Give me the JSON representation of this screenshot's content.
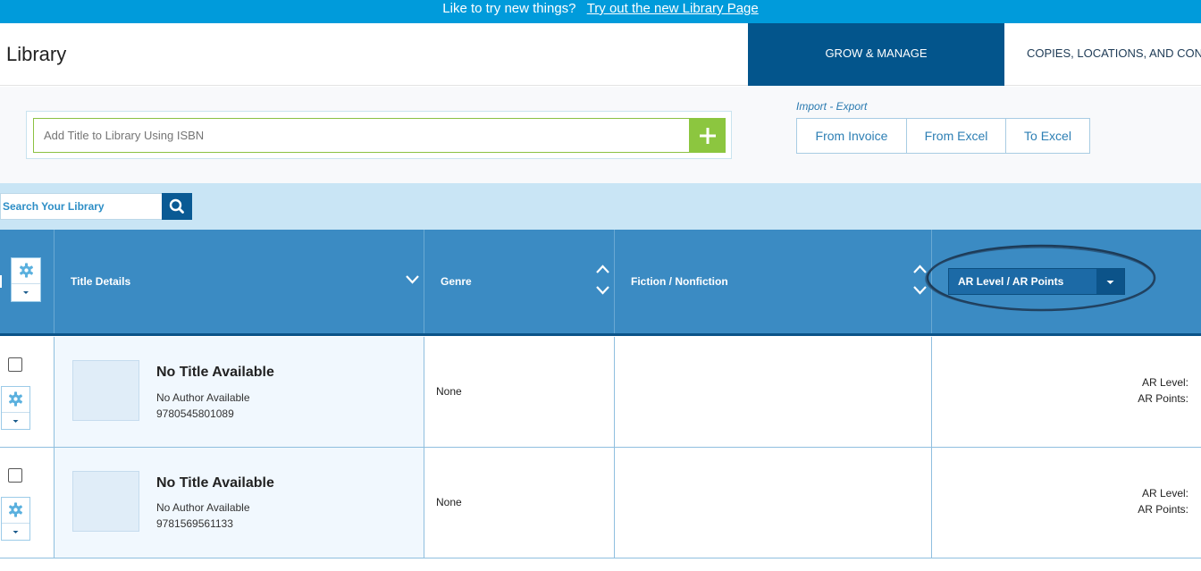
{
  "banner": {
    "prompt": "Like to try new things?",
    "link": "Try out the new Library Page"
  },
  "header": {
    "title": "Library",
    "tabs": [
      "GROW & MANAGE",
      "COPIES, LOCATIONS, AND COND"
    ],
    "active_tab": "GROW & MANAGE"
  },
  "isbn": {
    "placeholder": "Add Title to Library Using ISBN",
    "add_icon": "plus-icon"
  },
  "import_export": {
    "label": "Import - Export",
    "buttons": [
      "From Invoice",
      "From Excel",
      "To Excel"
    ]
  },
  "search": {
    "placeholder": "Search Your Library",
    "icon": "search-icon"
  },
  "table": {
    "columns": {
      "title": "Title Details",
      "genre": "Genre",
      "fiction": "Fiction / Nonfiction",
      "ar": "AR Level / AR Points"
    },
    "rows": [
      {
        "title": "No Title Available",
        "author": "No Author Available",
        "isbn": "9780545801089",
        "genre": "None",
        "ar_level_label": "AR Level:",
        "ar_points_label": "AR Points:"
      },
      {
        "title": "No Title Available",
        "author": "No Author Available",
        "isbn": "9781569561133",
        "genre": "None",
        "ar_level_label": "AR Level:",
        "ar_points_label": "AR Points:"
      }
    ]
  },
  "colors": {
    "banner": "#009bdb",
    "active_tab": "#03558c",
    "add_button": "#8cc63f",
    "table_header": "#3b8bc3"
  }
}
